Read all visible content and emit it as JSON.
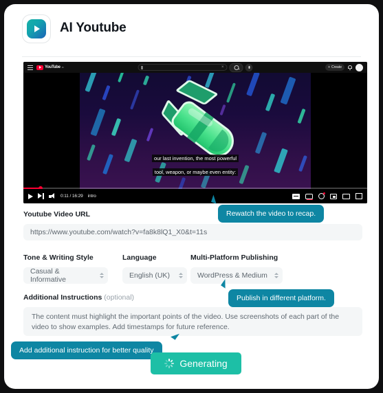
{
  "header": {
    "title": "AI Youtube",
    "icon": "youtube-play-icon",
    "icon_gradient_from": "#17b0a6",
    "icon_gradient_to": "#1b63b8"
  },
  "video": {
    "topbar": {
      "menu_icon": "hamburger-icon",
      "logo_text": "YouTube",
      "logo_superscript": "IN",
      "search_placeholder": "",
      "clear_icon": "close-icon",
      "search_icon": "search-icon",
      "mic_icon": "microphone-icon",
      "create_label": "Create",
      "notifications_icon": "bell-icon",
      "avatar": "user-avatar"
    },
    "caption_line_1": "our last invention, the most powerful",
    "caption_line_2": "tool, weapon, or maybe even entity:",
    "controls": {
      "play_icon": "play-icon",
      "next_icon": "next-icon",
      "volume_icon": "volume-icon",
      "timecode": "0:11 / 16:29",
      "chapter": "intro",
      "subtitles_icon": "closed-captions-icon",
      "autoplay_icon": "autoplay-icon",
      "settings_icon": "gear-icon",
      "miniplayer_icon": "miniplayer-icon",
      "theater_icon": "theater-mode-icon",
      "fullscreen_icon": "fullscreen-icon"
    }
  },
  "form": {
    "url_label": "Youtube Video URL",
    "url_value": "https://www.youtube.com/watch?v=fa8k8lQ1_X0&t=11s",
    "tone_label": "Tone & Writing Style",
    "tone_value": "Casual & Informative",
    "language_label": "Language",
    "language_value": "English (UK)",
    "publishing_label": "Multi-Platform Publishing",
    "publishing_value": "WordPress & Medium",
    "instructions_label": "Additional Instructions",
    "instructions_optional": "(optional)",
    "instructions_value": "The content must highlight the important points of the video. Use screenshots of each part of the video to show examples. Add timestamps for future reference."
  },
  "tooltips": {
    "rewatch": "Rewatch the video to recap.",
    "publish": "Publish in different platform.",
    "additional": "Add additional instruction for better quality",
    "color": "#0e86a3"
  },
  "actions": {
    "generate_label": "Generating",
    "generate_color": "#1dbfa6",
    "spinner_icon": "loading-spinner-icon"
  }
}
